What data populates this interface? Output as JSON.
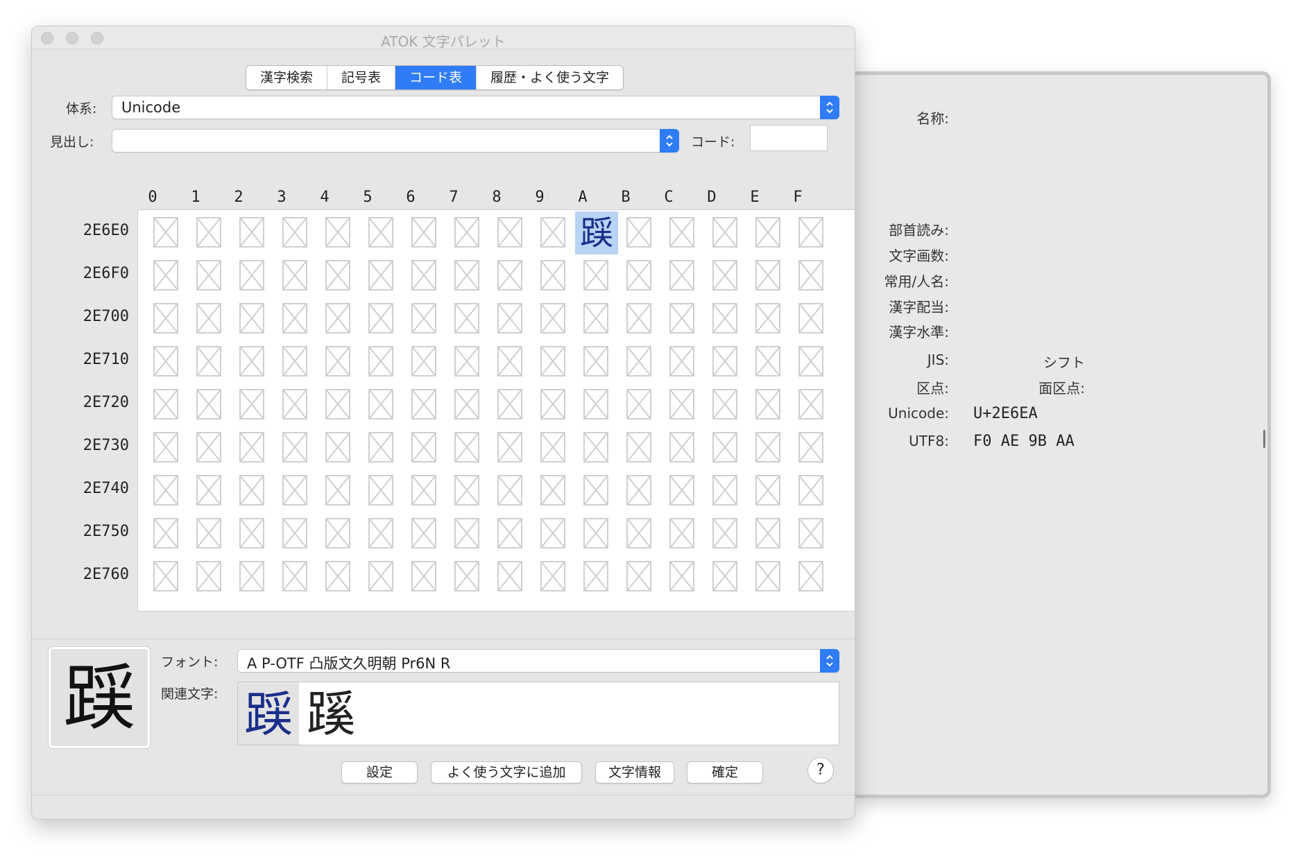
{
  "window": {
    "title": "ATOK 文字パレット"
  },
  "tabs": [
    {
      "label": "漢字検索",
      "active": false
    },
    {
      "label": "記号表",
      "active": false
    },
    {
      "label": "コード表",
      "active": true
    },
    {
      "label": "履歴・よく使う文字",
      "active": false
    }
  ],
  "form": {
    "system_label": "体系:",
    "system_value": "Unicode",
    "heading_label": "見出し:",
    "heading_value": "",
    "code_label": "コード:",
    "code_value": ""
  },
  "grid": {
    "columns": [
      "0",
      "1",
      "2",
      "3",
      "4",
      "5",
      "6",
      "7",
      "8",
      "9",
      "A",
      "B",
      "C",
      "D",
      "E",
      "F"
    ],
    "rows": [
      "2E6E0",
      "2E6F0",
      "2E700",
      "2E710",
      "2E720",
      "2E730",
      "2E740",
      "2E750",
      "2E760"
    ],
    "selected": {
      "row": "2E6E0",
      "column": "A",
      "char": "𮛪"
    },
    "missing_glyph_icon": "missing-glyph-box-icon"
  },
  "bottom": {
    "preview_char": "𮛪",
    "font_label": "フォント:",
    "font_value": "A P-OTF 凸版文久明朝 Pr6N R",
    "related_label": "関連文字:",
    "related_chars": [
      "𮛪",
      "蹊"
    ],
    "buttons": {
      "settings": "設定",
      "add_favorite": "よく使う文字に追加",
      "char_info": "文字情報",
      "confirm": "確定",
      "help": "?"
    }
  },
  "info": {
    "name_label": "名称:",
    "radical_label": "部首読み:",
    "strokes_label": "文字画数:",
    "joyo_label": "常用/人名:",
    "grade_label": "漢字配当:",
    "level_label": "漢字水準:",
    "jis_label": "JIS:",
    "shift_label": "シフト",
    "kuten_label": "区点:",
    "menkuten_label": "面区点:",
    "unicode_label": "Unicode:",
    "unicode_value": "U+2E6EA",
    "utf8_label": "UTF8:",
    "utf8_value": "F0 AE 9B AA"
  },
  "colors": {
    "accent": "#2f7cf6",
    "selected_cell": "#b9d3f5",
    "glyph_blue": "#1a2f8a"
  }
}
